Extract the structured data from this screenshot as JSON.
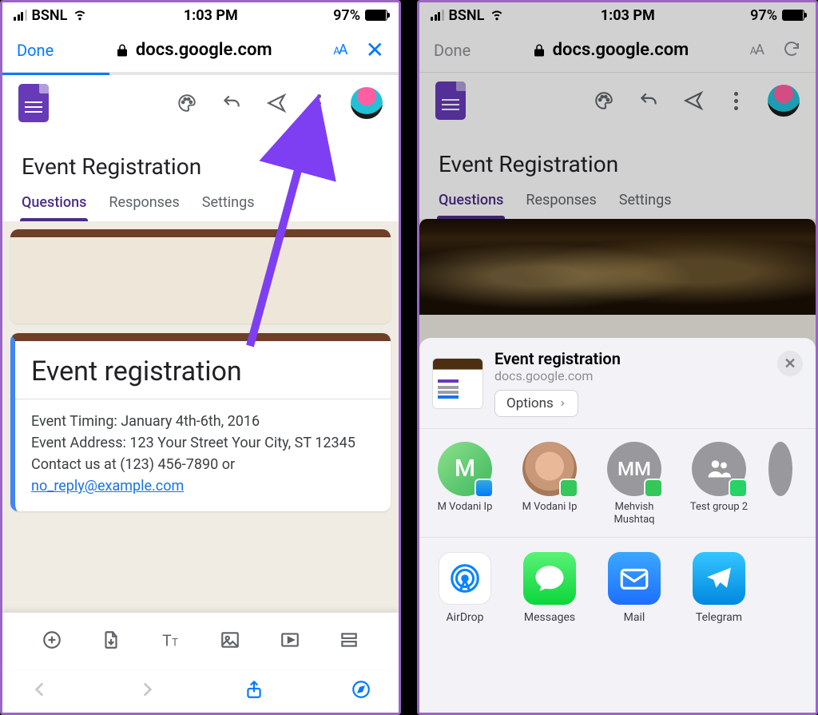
{
  "status": {
    "carrier": "BSNL",
    "time": "1:03 PM",
    "battery": "97%"
  },
  "safari": {
    "done": "Done",
    "domain": "docs.google.com"
  },
  "forms": {
    "title": "Event Registration",
    "tabs": {
      "q": "Questions",
      "r": "Responses",
      "s": "Settings"
    }
  },
  "card": {
    "heading": "Event registration",
    "line1": "Event Timing: January 4th-6th, 2016",
    "line2": "Event Address: 123 Your Street Your City, ST 12345",
    "line3a": "Contact us at (123) 456-7890 or ",
    "email": "no_reply@example.com"
  },
  "sheet": {
    "title": "Event registration",
    "sub": "docs.google.com",
    "options": "Options",
    "contacts": {
      "c1": "M Vodani Ip",
      "c1i": "M",
      "c2": "M Vodani Ip",
      "c3": "Mehvish Mushtaq",
      "c3i": "MM",
      "c4": "Test group 2"
    },
    "apps": {
      "airdrop": "AirDrop",
      "messages": "Messages",
      "mail": "Mail",
      "telegram": "Telegram"
    }
  }
}
